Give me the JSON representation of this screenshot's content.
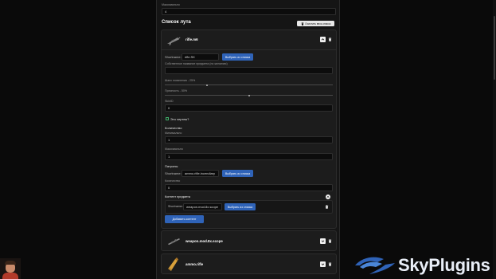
{
  "top": {
    "max_label": "Максимально",
    "max_value": "4"
  },
  "loot": {
    "heading": "Список лута",
    "clear_label": "Очистить весь список"
  },
  "item1": {
    "name": "rifle.m6",
    "shortname_label": "Shortname:",
    "shortname_value": "rifle.SK",
    "choose_label": "Выбрать из списка",
    "custom_name_label": "Собственное название предмета (по желанию)",
    "custom_name_value": "",
    "chance_label": "Шанс появления - 25%",
    "chance_value": 25,
    "durability_label": "Прочность - 50%",
    "durability_value": 50,
    "skin_label": "SkinID",
    "skin_value": "0",
    "blueprint_label": "Это чертеж?",
    "qty_heading": "Количество",
    "min_label": "Минимально",
    "min_value": "1",
    "max_label": "Максимально",
    "max_value": "1",
    "ammo_heading": "Патроны",
    "ammo_shortname_label": "Shortname:",
    "ammo_shortname_value": "ammo.rifle.incendiary",
    "ammo_choose_label": "Выбрать из списка",
    "ammo_qty_label": "Количество",
    "ammo_qty_value": "0",
    "contents_heading": "Контент предмета",
    "content_shortname_label": "Shortname:",
    "content_shortname_value": "weapon.mod.8x.scope",
    "content_choose_label": "Выбрать из списка",
    "add_content_label": "Добавить контент"
  },
  "item2": {
    "name": "weapon.mod.8x.scope"
  },
  "item3": {
    "name": "ammo.rifle"
  },
  "brand": {
    "name": "SkyPlugins",
    "accent": "#2f63b8"
  }
}
